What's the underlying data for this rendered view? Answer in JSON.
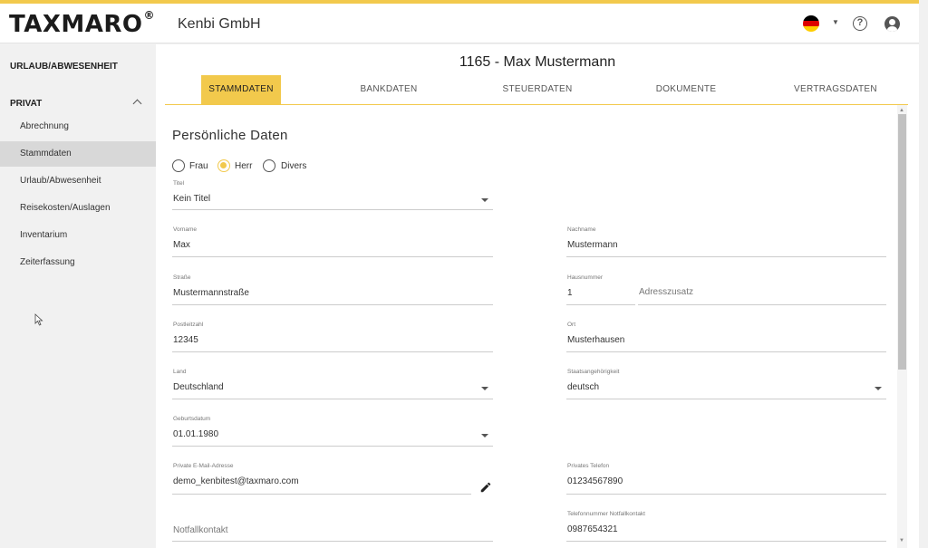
{
  "header": {
    "logo_text": "TAXMARO",
    "logo_mark": "®",
    "company": "Kenbi GmbH",
    "icons": [
      "flag-de-icon",
      "chevron-down-icon",
      "help-icon",
      "account-icon"
    ]
  },
  "sidebar": {
    "section1": "URLAUB/ABWESENHEIT",
    "section2": "PRIVAT",
    "items": [
      {
        "label": "Abrechnung",
        "active": false
      },
      {
        "label": "Stammdaten",
        "active": true
      },
      {
        "label": "Urlaub/Abwesenheit",
        "active": false
      },
      {
        "label": "Reisekosten/Auslagen",
        "active": false
      },
      {
        "label": "Inventarium",
        "active": false
      },
      {
        "label": "Zeiterfassung",
        "active": false
      }
    ]
  },
  "page": {
    "title": "1165 - Max Mustermann",
    "tabs": [
      {
        "label": "STAMMDATEN",
        "active": true
      },
      {
        "label": "BANKDATEN",
        "active": false
      },
      {
        "label": "STEUERDATEN",
        "active": false
      },
      {
        "label": "DOKUMENTE",
        "active": false
      },
      {
        "label": "VERTRAGSDATEN",
        "active": false
      }
    ]
  },
  "form": {
    "section_title": "Persönliche Daten",
    "gender": {
      "options": [
        "Frau",
        "Herr",
        "Divers"
      ],
      "selected": "Herr"
    },
    "titel": {
      "label": "Titel",
      "value": "Kein Titel"
    },
    "vorname": {
      "label": "Vorname",
      "value": "Max"
    },
    "nachname": {
      "label": "Nachname",
      "value": "Mustermann"
    },
    "strasse": {
      "label": "Straße",
      "value": "Mustermannstraße"
    },
    "hausnummer": {
      "label": "Hausnummer",
      "value": "1"
    },
    "adresszusatz": {
      "placeholder": "Adresszusatz"
    },
    "postleitzahl": {
      "label": "Postleitzahl",
      "value": "12345"
    },
    "ort": {
      "label": "Ort",
      "value": "Musterhausen"
    },
    "land": {
      "label": "Land",
      "value": "Deutschland"
    },
    "staatsangehoerigkeit": {
      "label": "Staatsangehörigkeit",
      "value": "deutsch"
    },
    "geburtsdatum": {
      "label": "Geburtsdatum",
      "value": "01.01.1980"
    },
    "email": {
      "label": "Private E-Mail-Adresse",
      "value": "demo_kenbitest@taxmaro.com"
    },
    "telefon": {
      "label": "Privates Telefon",
      "value": "01234567890"
    },
    "notfallkontakt": {
      "placeholder": "Notfallkontakt"
    },
    "telefon_notfall": {
      "label": "Telefonnummer Notfallkontakt",
      "value": "0987654321"
    }
  },
  "colors": {
    "accent": "#f2c94c",
    "sidebar_bg": "#f1f1f1",
    "sidebar_active": "#d8d8d8"
  }
}
